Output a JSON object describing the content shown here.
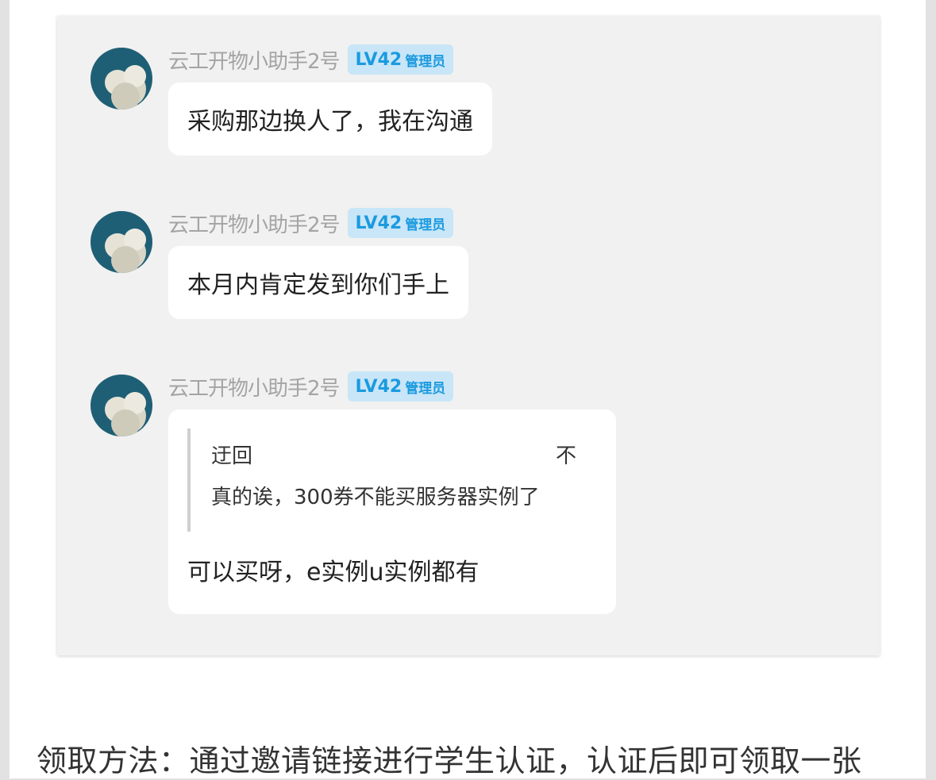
{
  "messages": [
    {
      "sender": "云工开物小助手2号",
      "level": "LV42",
      "role": "管理员",
      "text": "采购那边换人了，我在沟通"
    },
    {
      "sender": "云工开物小助手2号",
      "level": "LV42",
      "role": "管理员",
      "text": "本月内肯定发到你们手上"
    },
    {
      "sender": "云工开物小助手2号",
      "level": "LV42",
      "role": "管理员",
      "quote": {
        "author": "迂回",
        "flag": "不",
        "text": "真的诶，300券不能买服务器实例了"
      },
      "text": "可以买呀，e实例u实例都有"
    }
  ],
  "footer": {
    "text": "领取方法：通过邀请链接进行学生认证，认证后即可领取一张"
  },
  "colors": {
    "card_bg": "#f1f1f1",
    "badge_bg": "#c8e6f7",
    "badge_text": "#1b9ae0",
    "sender_text": "#a4a4a4",
    "avatar_bg": "#1f5f75"
  }
}
